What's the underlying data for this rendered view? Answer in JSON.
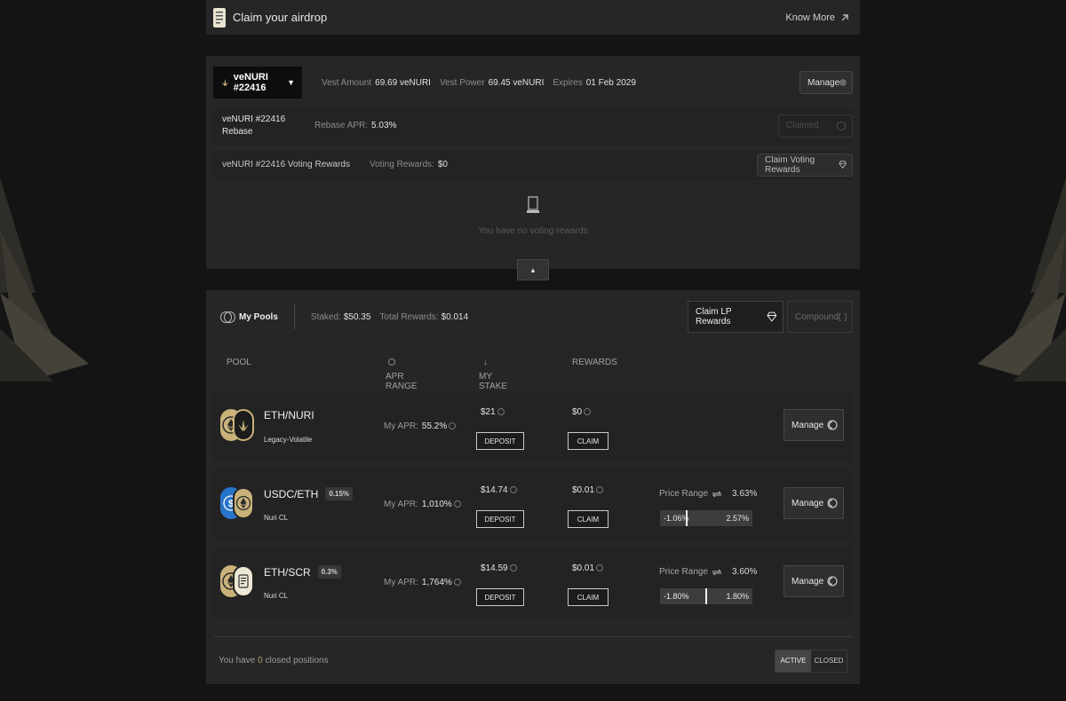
{
  "airdrop": {
    "title": "Claim your airdrop",
    "know_more": "Know More"
  },
  "vest": {
    "nft_label": "veNURI #22416",
    "vest_amount_label": "Vest Amount",
    "vest_amount": "69.69 veNURI",
    "vest_power_label": "Vest Power",
    "vest_power": "69.45 veNURI",
    "expires_label": "Expires",
    "expires": "01 Feb 2029",
    "manage_label": "Manage",
    "rebase_title_line1": "veNURI #22416",
    "rebase_title_line2": "Rebase",
    "rebase_apr_label": "Rebase APR:",
    "rebase_apr": "5.03%",
    "claimed_label": "Claimed",
    "voting_title": "veNURI #22416 Voting Rewards",
    "voting_rewards_label": "Voting Rewards:",
    "voting_rewards": "$0",
    "claim_voting_label": "Claim Voting Rewards",
    "empty_msg": "You have no voting rewards",
    "collapse_glyph": "▲"
  },
  "pools": {
    "title": "My Pools",
    "staked_label": "Staked:",
    "staked": "$50.35",
    "total_rewards_label": "Total Rewards:",
    "total_rewards": "$0.014",
    "claim_lp_label": "Claim LP Rewards",
    "compound_label": "Compound",
    "columns": {
      "pool": "POOL",
      "apr_range": "APR RANGE",
      "my_stake": "MY STAKE",
      "rewards": "REWARDS",
      "sort_glyph": "↓"
    },
    "rows": [
      {
        "name": "ETH/NURI",
        "fee": "",
        "type": "Legacy-Volatile",
        "my_apr_label": "My APR:",
        "my_apr": "55.2%",
        "stake": "$21",
        "deposit": "DEPOSIT",
        "rewards": "$0",
        "claim": "CLAIM",
        "manage": "Manage",
        "tokens": [
          "eth-token-icon",
          "nuri-token-icon"
        ]
      },
      {
        "name": "USDC/ETH",
        "fee": "0.15%",
        "type": "Nuri CL",
        "my_apr_label": "My APR:",
        "my_apr": "1,010%",
        "stake": "$14.74",
        "deposit": "DEPOSIT",
        "rewards": "$0.01",
        "claim": "CLAIM",
        "price_range_label": "Price Range",
        "price_range_pct": "3.63%",
        "range_low": "-1.06%",
        "range_high": "2.57%",
        "range_position": 0.29,
        "manage": "Manage",
        "tokens": [
          "usdc-token-icon",
          "eth-token-icon"
        ]
      },
      {
        "name": "ETH/SCR",
        "fee": "0.3%",
        "type": "Nuri CL",
        "my_apr_label": "My APR:",
        "my_apr": "1,764%",
        "stake": "$14.59",
        "deposit": "DEPOSIT",
        "rewards": "$0.01",
        "claim": "CLAIM",
        "price_range_label": "Price Range",
        "price_range_pct": "3.60%",
        "range_low": "-1.80%",
        "range_high": "1.80%",
        "range_position": 0.5,
        "manage": "Manage",
        "tokens": [
          "eth-token-icon",
          "scr-token-icon"
        ]
      }
    ],
    "footer": {
      "msg_prefix": "You have",
      "closed_count": "0",
      "msg_suffix": "closed positions",
      "active_label": "ACTIVE",
      "closed_label": "CLOSED"
    }
  },
  "colors": {
    "gold": "#c9b37a",
    "usdc_blue": "#2775ca",
    "panel": "#262626",
    "background": "#141414"
  }
}
